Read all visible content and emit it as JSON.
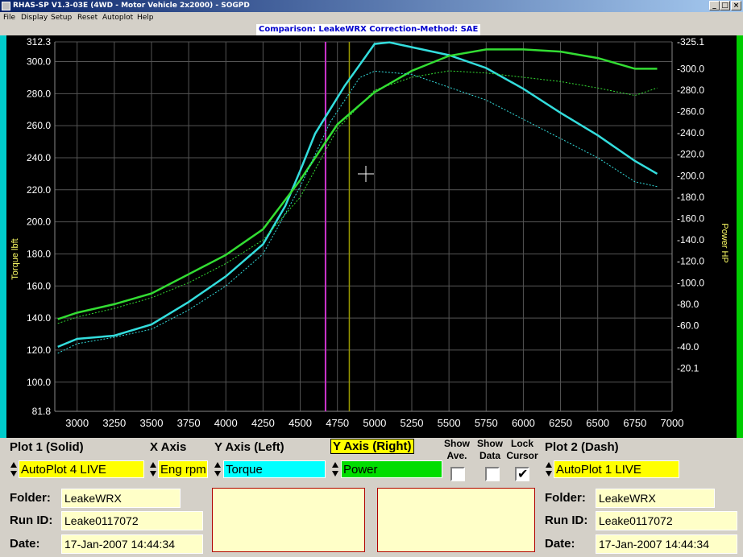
{
  "window": {
    "title": "RHAS-SP V1.3-03E  (4WD - Motor Vehicle 2x2000) - SOGPD"
  },
  "menu": [
    "File",
    "Display",
    "Setup",
    "Reset",
    "Autoplot",
    "Help"
  ],
  "chart_title": "Comparison: LeakeWRX    Correction-Method: SAE",
  "controls": {
    "plot1_label": "Plot 1 (Solid)",
    "plot1_value": "AutoPlot 4 LIVE",
    "xaxis_label": "X Axis",
    "xaxis_value": "Eng rpm",
    "yleft_label": "Y Axis (Left)",
    "yleft_value": "Torque",
    "yright_label": "Y Axis (Right)",
    "yright_value": "Power",
    "show_ave_label": "Show\nAve.",
    "show_data_label": "Show\nData",
    "lock_cursor_label": "Lock\nCursor",
    "show_ave_checked": false,
    "show_data_checked": false,
    "lock_cursor_checked": true,
    "plot2_label": "Plot 2 (Dash)",
    "plot2_value": "AutoPlot 1 LIVE"
  },
  "info_left": {
    "folder_label": "Folder:",
    "folder": "LeakeWRX",
    "runid_label": "Run ID:",
    "runid": "Leake0117072",
    "date_label": "Date:",
    "date": "17-Jan-2007  14:44:34"
  },
  "info_right": {
    "folder_label": "Folder:",
    "folder": "LeakeWRX",
    "runid_label": "Run ID:",
    "runid": "Leake0117072",
    "date_label": "Date:",
    "date": "17-Jan-2007  14:44:34"
  },
  "colors": {
    "torque": "#33dddd",
    "power": "#33dd33",
    "cursor_magenta": "#cc33cc",
    "cursor_olive": "#999900",
    "highlight_yellow": "#ffff00",
    "torque_box": "#00ffff",
    "power_box": "#00dd00"
  },
  "chart_data": {
    "type": "line",
    "xlabel": "",
    "ylabel": "Torque  lbft",
    "y2label": "Power  HP",
    "xlim": [
      2850,
      7000
    ],
    "ylim": [
      81.8,
      312.3
    ],
    "y2lim": [
      -20.1,
      325.1
    ],
    "x_ticks": [
      3000,
      3250,
      3500,
      3750,
      4000,
      4250,
      4500,
      4750,
      5000,
      5250,
      5500,
      5750,
      6000,
      6250,
      6500,
      6750,
      7000
    ],
    "y_ticks_left": [
      "81.8",
      "100.0",
      "120.0",
      "140.0",
      "160.0",
      "180.0",
      "200.0",
      "220.0",
      "240.0",
      "260.0",
      "280.0",
      "300.0",
      "312.3"
    ],
    "y_ticks_right": [
      "-20.1",
      "-40.0",
      "-60.0",
      "-80.0",
      "-100.0",
      "-120.0",
      "-140.0",
      "-160.0",
      "-180.0",
      "-200.0",
      "-220.0",
      "-240.0",
      "-260.0",
      "-280.0",
      "-300.0",
      "-325.1"
    ],
    "cursors": [
      4670,
      4830
    ],
    "series": [
      {
        "name": "Torque",
        "axis": "left",
        "style": "solid",
        "x": [
          2870,
          3000,
          3250,
          3500,
          3750,
          4000,
          4250,
          4400,
          4500,
          4600,
          4700,
          4800,
          4900,
          5000,
          5100,
          5250,
          5500,
          5750,
          6000,
          6250,
          6500,
          6750,
          6900
        ],
        "y": [
          122,
          127,
          129,
          136,
          150,
          166,
          186,
          210,
          232,
          255,
          270,
          285,
          298,
          311,
          312,
          309,
          304,
          296,
          283,
          268,
          254,
          238,
          230
        ]
      },
      {
        "name": "Power",
        "axis": "right",
        "style": "solid",
        "x": [
          2870,
          3000,
          3250,
          3500,
          3750,
          4000,
          4250,
          4500,
          4750,
          5000,
          5250,
          5500,
          5750,
          6000,
          6250,
          6500,
          6750,
          6900
        ],
        "y": [
          66,
          72,
          80,
          90,
          108,
          126,
          150,
          196,
          248,
          278,
          298,
          312,
          318,
          318,
          316,
          310,
          300,
          300
        ]
      },
      {
        "name": "Torque (Plot 2)",
        "axis": "left",
        "style": "dash",
        "x": [
          2870,
          3000,
          3250,
          3500,
          3750,
          4000,
          4250,
          4500,
          4700,
          4900,
          5000,
          5250,
          5500,
          5750,
          6000,
          6250,
          6500,
          6750,
          6900
        ],
        "y": [
          118,
          124,
          128,
          133,
          145,
          160,
          180,
          222,
          262,
          290,
          294,
          292,
          284,
          276,
          264,
          252,
          240,
          225,
          222
        ]
      },
      {
        "name": "Power (Plot 2)",
        "axis": "right",
        "style": "dash",
        "x": [
          2870,
          3000,
          3250,
          3500,
          3750,
          4000,
          4250,
          4500,
          4750,
          5000,
          5250,
          5500,
          5750,
          6000,
          6250,
          6500,
          6750,
          6900
        ],
        "y": [
          62,
          68,
          76,
          86,
          100,
          118,
          140,
          180,
          244,
          280,
          292,
          298,
          296,
          292,
          288,
          282,
          275,
          282
        ]
      }
    ]
  }
}
